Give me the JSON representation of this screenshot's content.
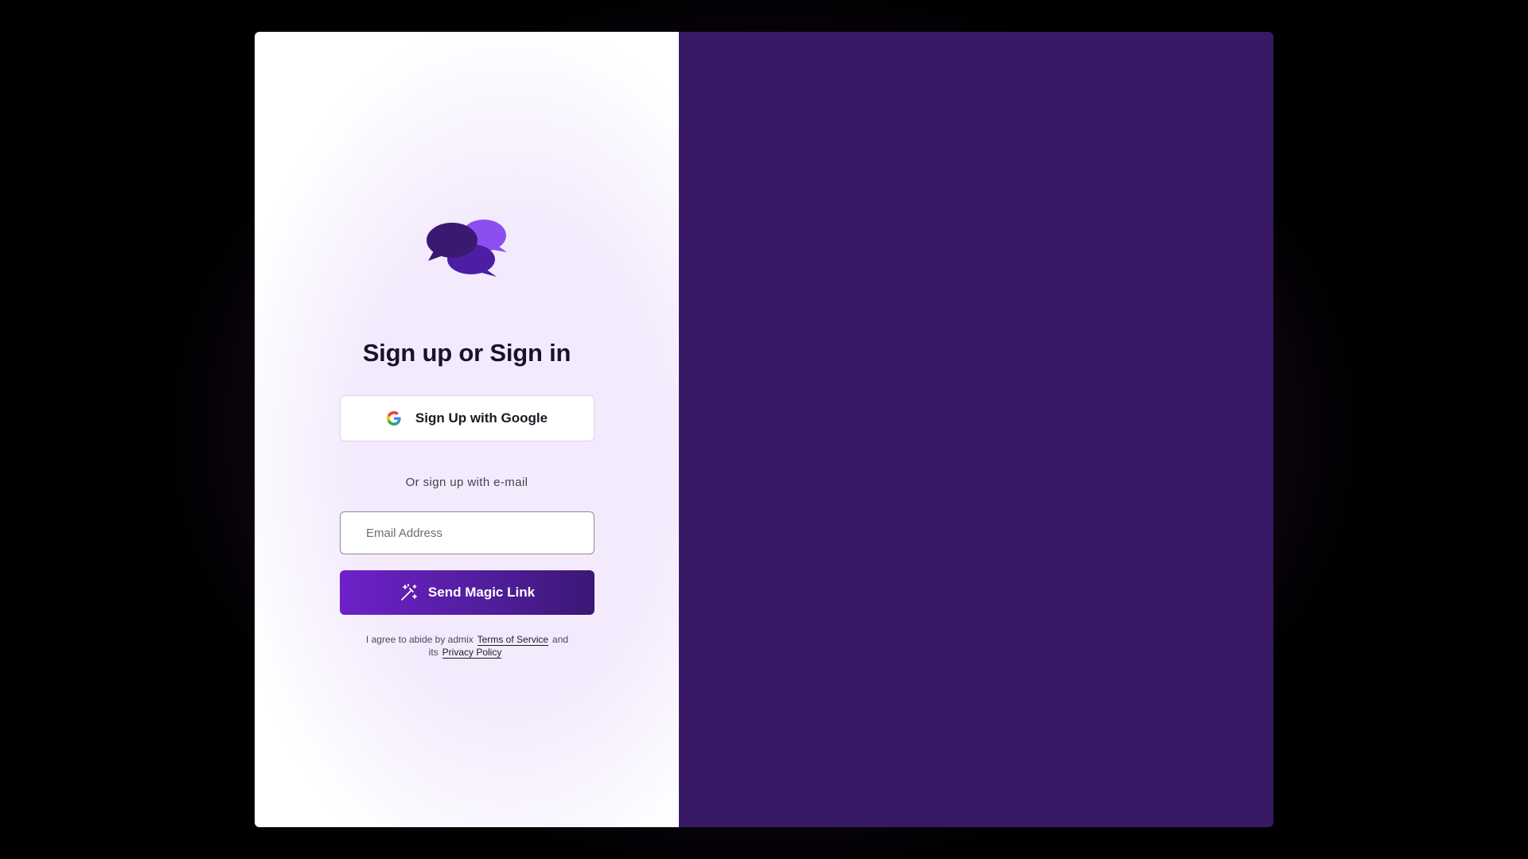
{
  "auth": {
    "logo_icon": "chat-bubbles-logo-icon",
    "heading": "Sign up or Sign in",
    "google_button": {
      "label": "Sign Up with Google",
      "icon": "google-icon"
    },
    "divider_text": "Or sign up with e-mail",
    "email_field": {
      "placeholder": "Email Address",
      "value": ""
    },
    "magic_button": {
      "label": "Send Magic Link",
      "icon": "magic-wand-icon"
    },
    "terms": {
      "prefix": "I agree to abide by admix",
      "terms_link": "Terms of Service",
      "conjunction": "and",
      "its": "its",
      "privacy_link": "Privacy Policy"
    }
  },
  "colors": {
    "page_background": "#000000",
    "right_panel": "#381966",
    "accent_start": "#6f20c9",
    "accent_end": "#3b1773",
    "heading_text": "#161428",
    "logo_dark": "#3a1970",
    "logo_mid": "#4b1ea4",
    "logo_light": "#8b4ff0"
  }
}
